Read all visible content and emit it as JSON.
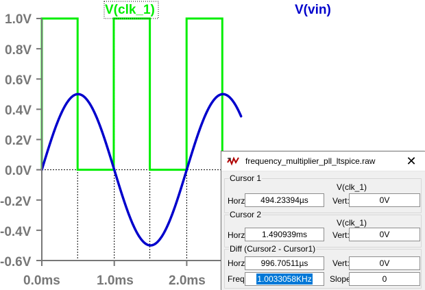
{
  "plot": {
    "trace_labels": [
      "V(clk_1)",
      "V(vin)"
    ],
    "y_tick_labels": [
      "1.0V",
      "0.8V",
      "0.6V",
      "0.4V",
      "0.2V",
      "0.0V",
      "-0.2V",
      "-0.4V",
      "-0.6V"
    ],
    "x_tick_labels": [
      "0.0ms",
      "1.0ms",
      "2.0ms"
    ],
    "colors": {
      "clk": "#00ee00",
      "vin": "#0000cc",
      "axis": "#777777",
      "grid": "#000000"
    }
  },
  "chart_data": {
    "type": "line",
    "title": "",
    "xlabel": "",
    "ylabel": "",
    "x_unit": "ms",
    "y_unit": "V",
    "xlim": [
      0,
      2.77
    ],
    "ylim": [
      -0.6,
      1.0
    ],
    "series": [
      {
        "name": "V(clk_1)",
        "color": "#00ee00",
        "x": [
          0.0,
          0.0,
          0.494,
          0.494,
          0.993,
          0.993,
          1.491,
          1.491,
          1.998,
          1.998,
          2.491,
          2.491,
          2.75
        ],
        "values": [
          0,
          1,
          1,
          0,
          0,
          1,
          1,
          0,
          0,
          1,
          1,
          0,
          0
        ]
      },
      {
        "name": "V(vin)",
        "color": "#0000cc",
        "x": [
          0.0,
          0.25,
          0.5,
          0.75,
          1.0,
          1.25,
          1.5,
          1.75,
          2.0,
          2.25,
          2.5,
          2.75
        ],
        "values": [
          0.0,
          0.354,
          0.5,
          0.354,
          0.0,
          -0.354,
          -0.5,
          -0.354,
          0.0,
          0.354,
          0.5,
          0.354
        ]
      }
    ],
    "cursors": [
      {
        "name": "Cursor 1",
        "x": 0.494
      },
      {
        "name": "Cursor 2",
        "x": 1.491
      }
    ],
    "grid": true,
    "legend": "top"
  },
  "dialog": {
    "title": "frequency_multiplier_pll_ltspice.raw",
    "cursor1": {
      "title": "Cursor 1",
      "trace": "V(clk_1)",
      "horz_label": "Horz:",
      "horz_value": "494.23394µs",
      "vert_label": "Vert:",
      "vert_value": "0V"
    },
    "cursor2": {
      "title": "Cursor 2",
      "trace": "V(clk_1)",
      "horz_label": "Horz:",
      "horz_value": "1.490939ms",
      "vert_label": "Vert:",
      "vert_value": "0V"
    },
    "diff": {
      "title": "Diff (Cursor2 - Cursor1)",
      "horz_label": "Horz:",
      "horz_value": "996.70511µs",
      "vert_label": "Vert:",
      "vert_value": "0V",
      "freq_label": "Freq:",
      "freq_value": "1.0033058KHz",
      "slope_label": "Slope:",
      "slope_value": "0"
    },
    "close_symbol": "✕",
    "icon_name": "ltspice-waveform-icon"
  }
}
